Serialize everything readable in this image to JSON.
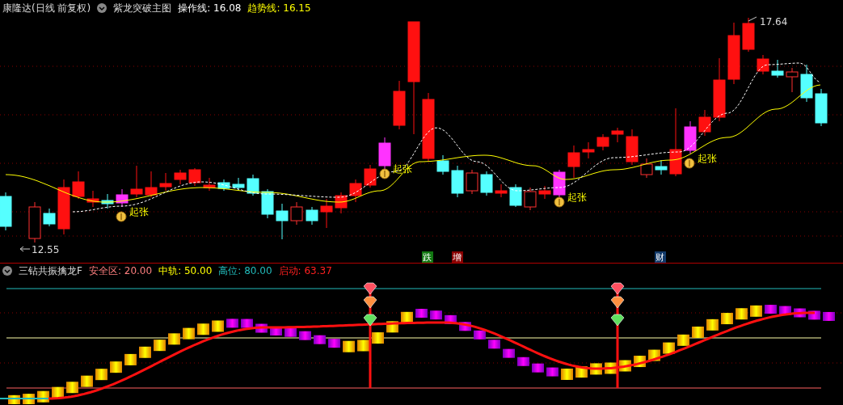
{
  "header": {
    "stock": "康隆达(日线 前复权)",
    "indicator": "紫龙突破主图",
    "lines": [
      {
        "text": "操作线: 16.08",
        "color": "#ffffff"
      },
      {
        "text": "趋势线: 16.15",
        "color": "#ffff00"
      }
    ]
  },
  "main_chart": {
    "price_labels": [
      {
        "text": "17.64"
      },
      {
        "text": "12.55"
      }
    ],
    "signals": [
      {
        "text": "起张"
      },
      {
        "text": "起张"
      },
      {
        "text": "起张"
      },
      {
        "text": "起张"
      }
    ],
    "markers": [
      {
        "text": "跌",
        "color": "#117711"
      },
      {
        "text": "增",
        "color": "#880000"
      },
      {
        "text": "财",
        "color": "#123a6a"
      }
    ]
  },
  "lower": {
    "indicator": "三钻共振擒龙F",
    "values": [
      {
        "text": "安全区: 20.00",
        "color": "#ff7f7f"
      },
      {
        "text": "中轨: 50.00",
        "color": "#ffff00"
      },
      {
        "text": "高位: 80.00",
        "color": "#22bbbb"
      },
      {
        "text": "启动: 63.37",
        "color": "#ff2020"
      }
    ]
  }
}
